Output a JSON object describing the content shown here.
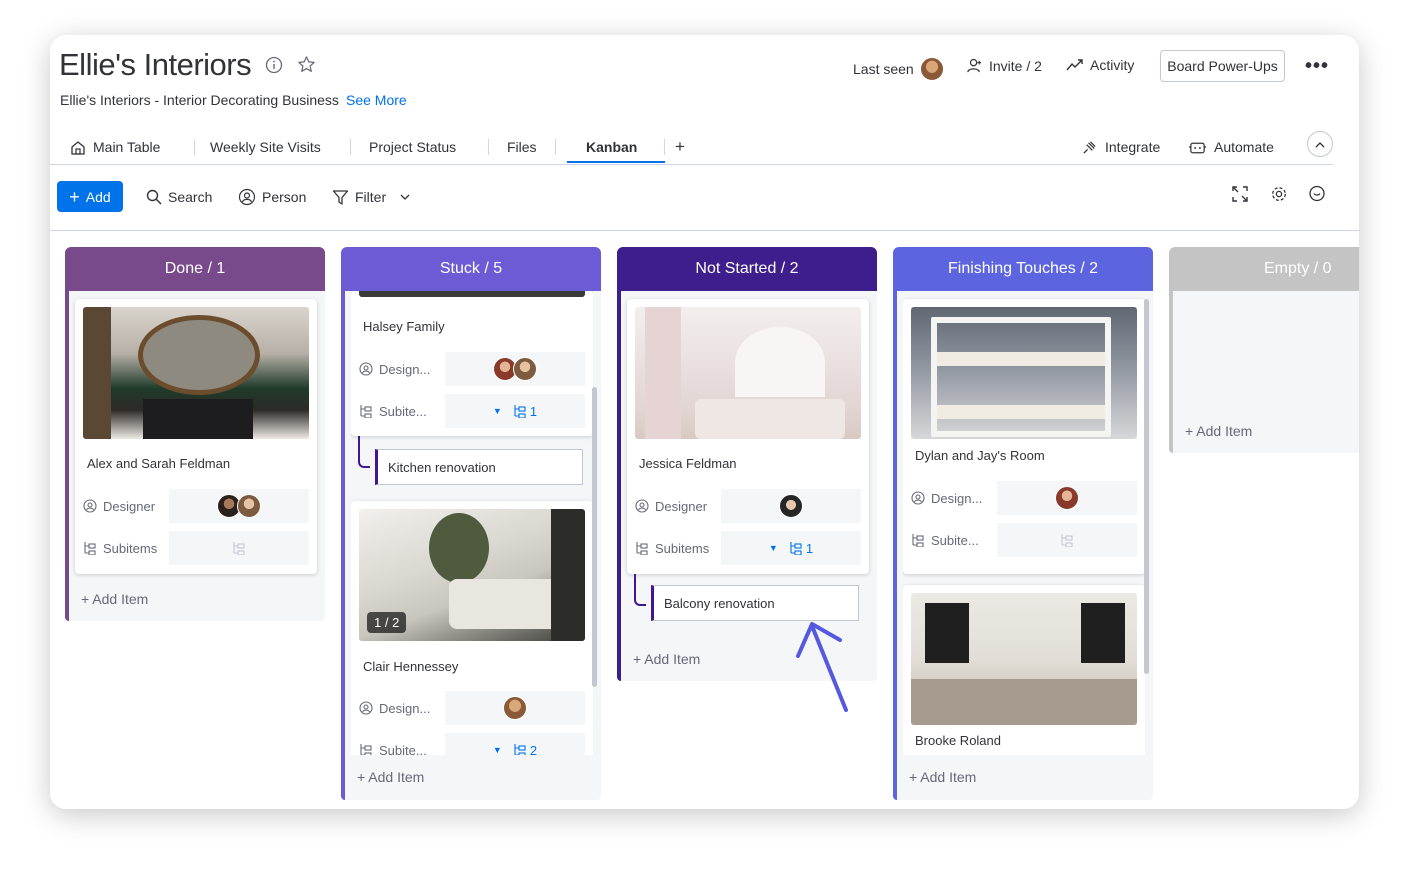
{
  "header": {
    "title": "Ellie's Interiors",
    "subtitle": "Ellie's Interiors - Interior Decorating Business",
    "see_more": "See More",
    "last_seen": "Last seen",
    "invite": "Invite / 2",
    "activity": "Activity",
    "power_ups": "Board Power-Ups"
  },
  "tabs": [
    {
      "label": "Main Table",
      "icon": "home-icon"
    },
    {
      "label": "Weekly Site Visits"
    },
    {
      "label": "Project Status"
    },
    {
      "label": "Files"
    },
    {
      "label": "Kanban",
      "active": true
    }
  ],
  "tab_actions": {
    "add": "+",
    "integrate": "Integrate",
    "automate": "Automate"
  },
  "toolbar": {
    "add": "Add",
    "search": "Search",
    "person": "Person",
    "filter": "Filter"
  },
  "add_item_label": "+ Add Item",
  "columns": [
    {
      "title": "Done / 1",
      "color": "#784bd1",
      "head_color": "#784a8c",
      "cards": [
        {
          "name": "Alex and Sarah Feldman",
          "designer_label": "Designer",
          "subitems_label": "Subitems"
        }
      ]
    },
    {
      "title": "Stuck / 5",
      "color": "#6b4fd1",
      "head_color": "#6c5bd4",
      "cards": [
        {
          "name": "Halsey Family",
          "designer_label": "Design...",
          "subitems_label": "Subite...",
          "subitem_count": "1",
          "subitem": "Kitchen renovation"
        },
        {
          "name": "Clair Hennessey",
          "designer_label": "Design...",
          "subitems_label": "Subite...",
          "subitem_count": "2",
          "image_badge": "1 / 2"
        }
      ]
    },
    {
      "title": "Not Started / 2",
      "color": "#401694",
      "head_color": "#3e1e8c",
      "cards": [
        {
          "name": "Jessica Feldman",
          "designer_label": "Designer",
          "subitems_label": "Subitems",
          "subitem_count": "1",
          "subitem": "Balcony renovation"
        }
      ]
    },
    {
      "title": "Finishing Touches / 2",
      "color": "#5559df",
      "head_color": "#5c64e0",
      "cards": [
        {
          "name": "Dylan and Jay's Room",
          "designer_label": "Design...",
          "subitems_label": "Subite..."
        },
        {
          "name": "Brooke Roland"
        }
      ]
    },
    {
      "title": "Empty / 0",
      "color": "#c4c4c4",
      "head_color": "#c4c4c4",
      "cards": []
    }
  ]
}
